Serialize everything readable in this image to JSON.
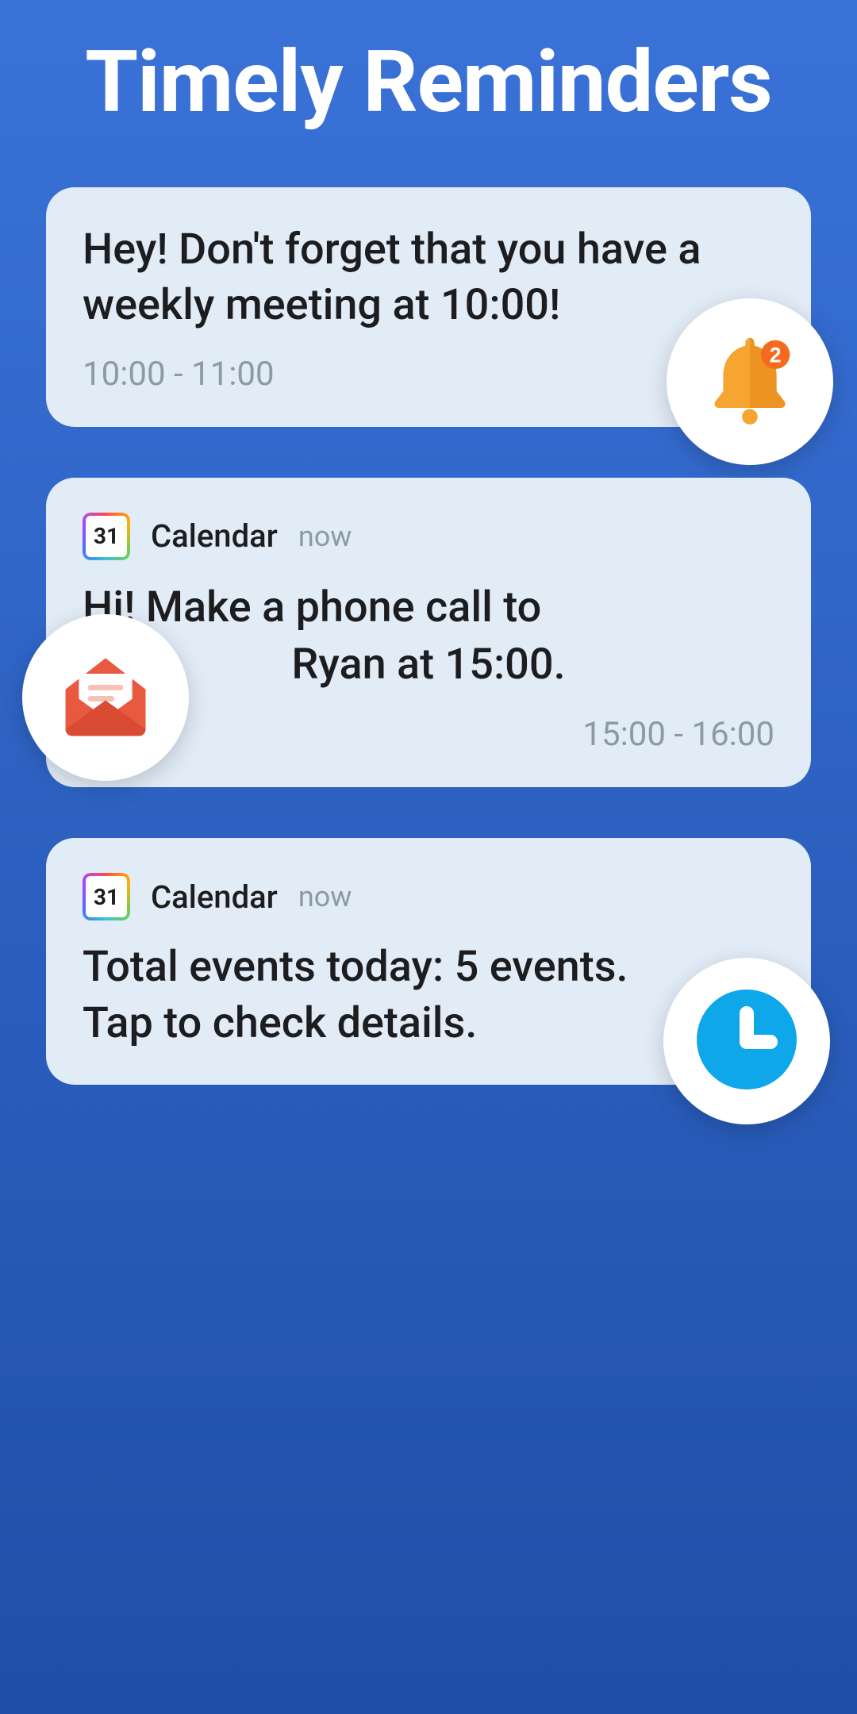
{
  "header": {
    "title": "Timely Reminders"
  },
  "cards": [
    {
      "body": "Hey! Don't forget that you have a weekly meeting at 10:00!",
      "time_range": "10:00 - 11:00",
      "bubble": {
        "icon": "bell-icon",
        "badge_count": "2"
      }
    },
    {
      "app_icon_text": "31",
      "app_name": "Calendar",
      "app_time": "now",
      "body_line1": "Hi! Make a phone call to",
      "body_line2": "Ryan at 15:00.",
      "time_range": "15:00 - 16:00",
      "bubble": {
        "icon": "envelope-icon"
      }
    },
    {
      "app_icon_text": "31",
      "app_name": "Calendar",
      "app_time": "now",
      "body": "Total events today: 5 events. Tap to check details.",
      "bubble": {
        "icon": "clock-icon"
      }
    }
  ]
}
